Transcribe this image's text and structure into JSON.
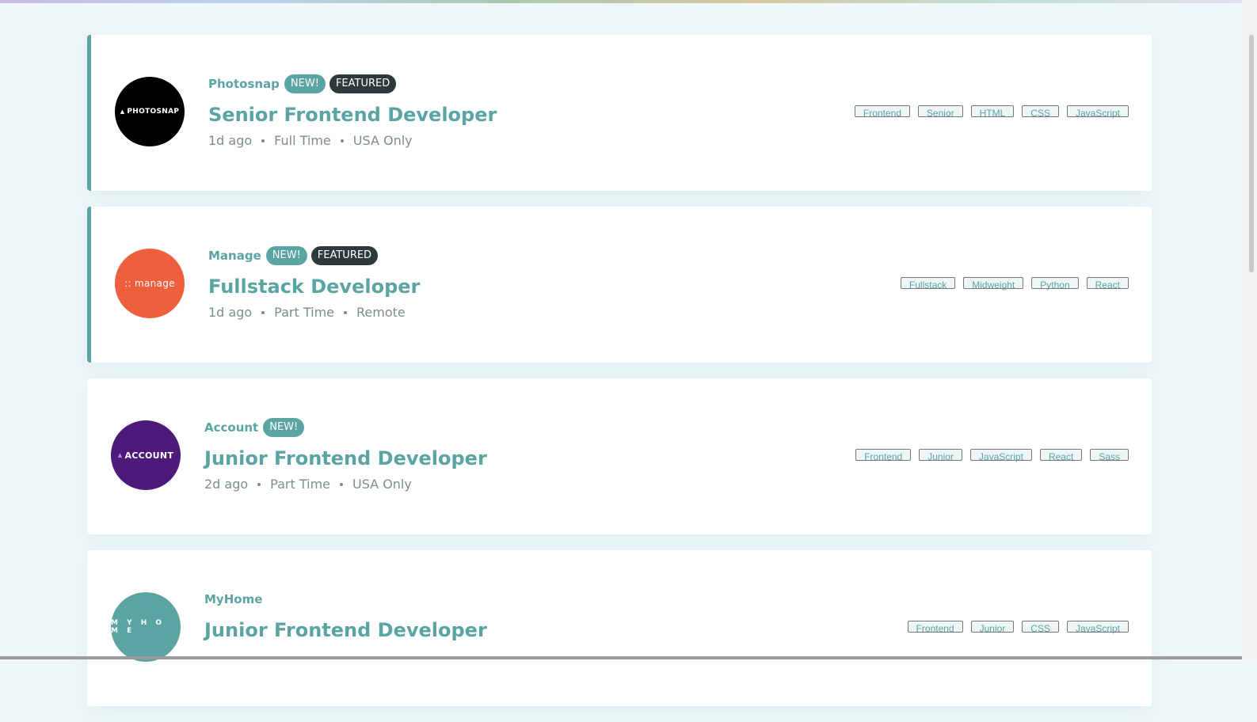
{
  "jobs": [
    {
      "company": "Photosnap",
      "logo_text": "PHOTOSNAP",
      "logo_color": "#000000",
      "new": "NEW!",
      "featured": "FEATURED",
      "position": "Senior Frontend Developer",
      "posted": "1d ago",
      "contract": "Full Time",
      "location": "USA Only",
      "tags": [
        "Frontend",
        "Senior",
        "HTML",
        "CSS",
        "JavaScript"
      ]
    },
    {
      "company": "Manage",
      "logo_text": ":: manage",
      "logo_color": "#ee5f3d",
      "new": "NEW!",
      "featured": "FEATURED",
      "position": "Fullstack Developer",
      "posted": "1d ago",
      "contract": "Part Time",
      "location": "Remote",
      "tags": [
        "Fullstack",
        "Midweight",
        "Python",
        "React"
      ]
    },
    {
      "company": "Account",
      "logo_text": "ACCOUNT",
      "logo_color": "#4d1a7a",
      "new": "NEW!",
      "position": "Junior Frontend Developer",
      "posted": "2d ago",
      "contract": "Part Time",
      "location": "USA Only",
      "tags": [
        "Frontend",
        "Junior",
        "JavaScript",
        "React",
        "Sass"
      ]
    },
    {
      "company": "MyHome",
      "logo_text": "M Y H O M E",
      "logo_color": "#5ba4a4",
      "position": "Junior Frontend Developer",
      "tags": [
        "Frontend",
        "Junior",
        "CSS",
        "JavaScript"
      ]
    }
  ],
  "colors": {
    "accent": "#5ba4a4",
    "featured_badge": "#2c3a3a",
    "background": "#eff7f8"
  }
}
